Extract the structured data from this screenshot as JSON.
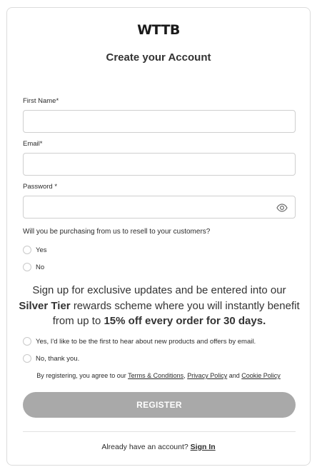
{
  "brand": {
    "logo_text": "WTTB"
  },
  "form": {
    "title": "Create your Account",
    "first_name": {
      "label": "First Name*",
      "value": "",
      "placeholder": ""
    },
    "email": {
      "label": "Email*",
      "value": "",
      "placeholder": ""
    },
    "password": {
      "label": "Password *",
      "value": "",
      "placeholder": "",
      "toggle_icon": "eye-icon"
    },
    "resell_question": "Will you be purchasing from us to resell to your customers?",
    "resell_options": [
      "Yes",
      "No"
    ]
  },
  "promo": {
    "text_1": "Sign up for exclusive updates and be entered into our",
    "tier": "Silver Tier",
    "text_2": "rewards scheme where you will instantly benefit from up to",
    "offer": "15% off every order for 30 days.",
    "options": [
      "Yes, I'd like to be the first to hear about new products and offers by email.",
      "No, thank you."
    ]
  },
  "terms": {
    "prefix": "By registering, you agree to our",
    "terms_link": "Terms & Conditions",
    "sep": ",",
    "privacy_link": "Privacy Policy",
    "and": "and",
    "cookie_link": "Cookie Policy"
  },
  "register_label": "REGISTER",
  "signin": {
    "prompt": "Already have an account?",
    "link": "Sign In"
  },
  "colors": {
    "button_bg": "#a9a9a9",
    "border": "#cfcfcf",
    "text": "#2b2b2b"
  }
}
